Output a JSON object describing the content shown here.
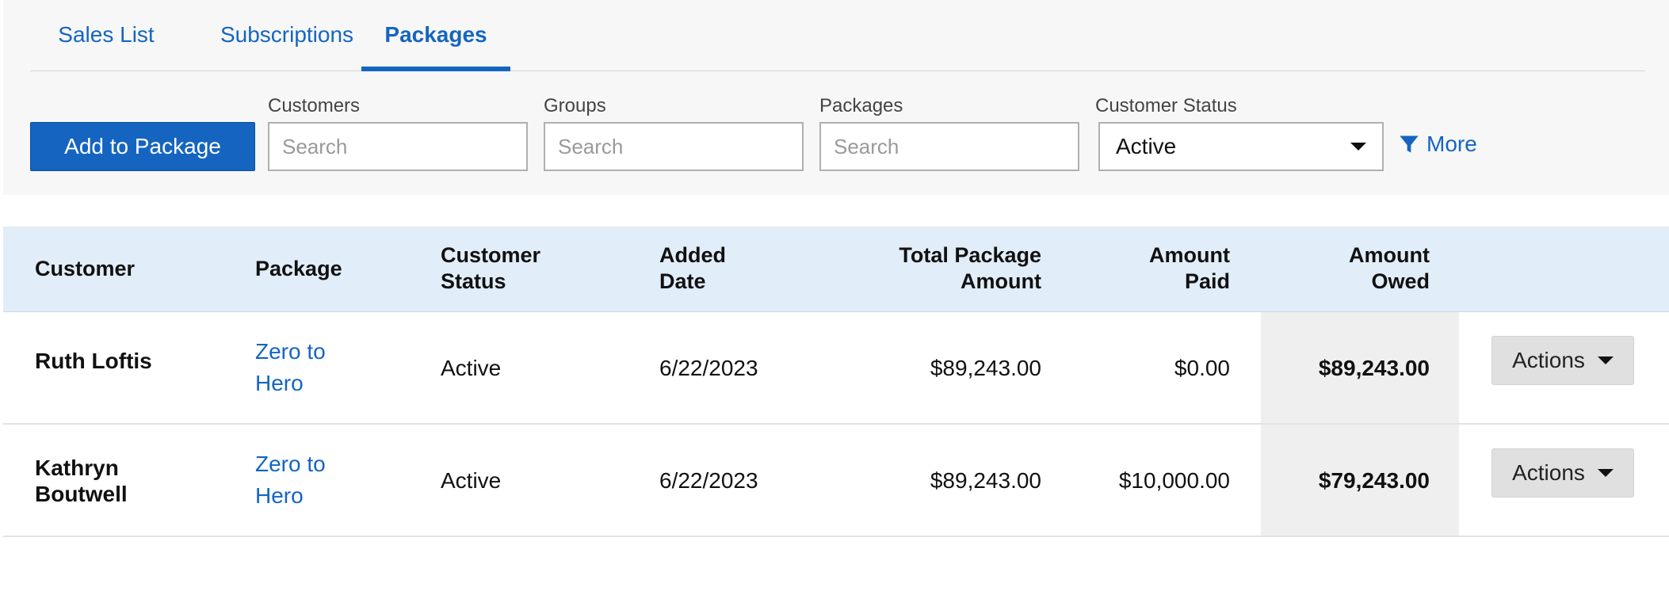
{
  "tabs": [
    {
      "label": "Sales List",
      "active": false
    },
    {
      "label": "Subscriptions",
      "active": false
    },
    {
      "label": "Packages",
      "active": true
    }
  ],
  "toolbar": {
    "add_label": "Add to Package",
    "filters": {
      "customers": {
        "label": "Customers",
        "placeholder": "Search"
      },
      "groups": {
        "label": "Groups",
        "placeholder": "Search"
      },
      "packages": {
        "label": "Packages",
        "placeholder": "Search"
      },
      "status": {
        "label": "Customer Status",
        "value": "Active"
      }
    },
    "more_label": "More",
    "more_icon": "filter-icon"
  },
  "table": {
    "headers": {
      "customer": "Customer",
      "package": "Package",
      "status_1": "Customer",
      "status_2": "Status",
      "added_1": "Added",
      "added_2": "Date",
      "total_1": "Total Package",
      "total_2": "Amount",
      "paid_1": "Amount",
      "paid_2": "Paid",
      "owed_1": "Amount",
      "owed_2": "Owed"
    },
    "rows": [
      {
        "customer_1": "Ruth Loftis",
        "customer_2": "",
        "package_1": "Zero to",
        "package_2": "Hero",
        "status": "Active",
        "added": "6/22/2023",
        "total": "$89,243.00",
        "paid": "$0.00",
        "owed": "$89,243.00",
        "actions_label": "Actions"
      },
      {
        "customer_1": "Kathryn",
        "customer_2": "Boutwell",
        "package_1": "Zero to",
        "package_2": "Hero",
        "status": "Active",
        "added": "6/22/2023",
        "total": "$89,243.00",
        "paid": "$10,000.00",
        "owed": "$79,243.00",
        "actions_label": "Actions"
      }
    ]
  },
  "colors": {
    "accent": "#1565c0",
    "header_bg": "#e1edf8",
    "panel_bg": "#f7f7f7",
    "owed_bg": "#efefef"
  }
}
